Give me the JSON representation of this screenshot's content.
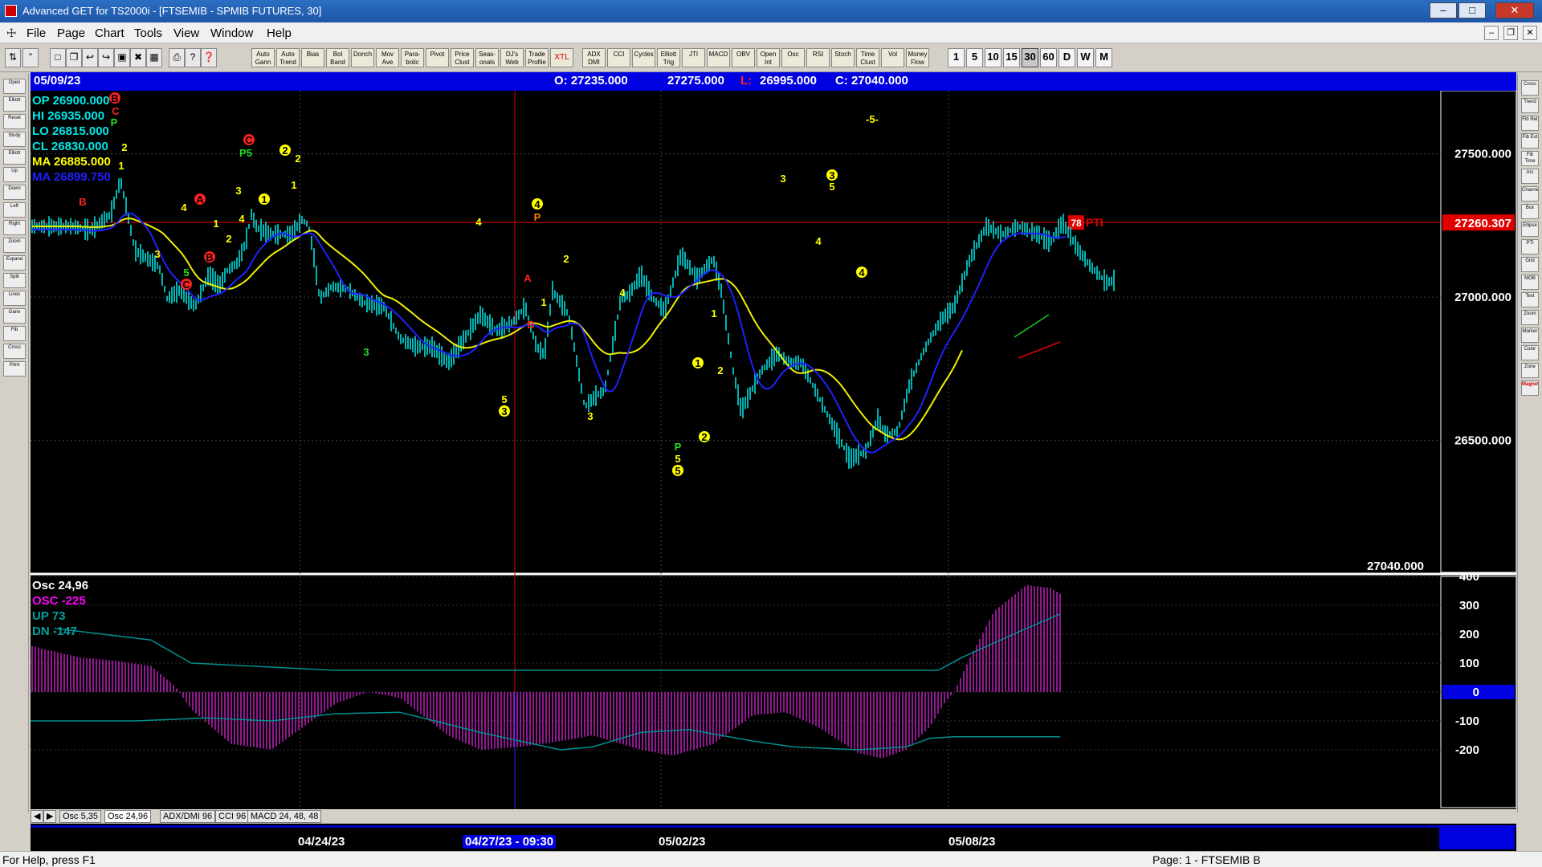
{
  "window": {
    "title": "Advanced GET for TS2000i - [FTSEMIB - SPMIB FUTURES, 30]"
  },
  "menu": [
    "File",
    "Page",
    "Chart",
    "Tools",
    "View",
    "Window",
    "Help"
  ],
  "toolbar": {
    "studies": [
      "Auto Gann",
      "Auto Trend",
      "Bias",
      "Bol Band",
      "Donch",
      "Mov Ave",
      "Para-bolic",
      "Pivot",
      "Price Clust",
      "Seas-onals",
      "DJ's Web",
      "Trade Profile",
      "XTL",
      "ADX DMI",
      "CCI",
      "Cycles",
      "Elliott Trig",
      "JTI",
      "MACD",
      "OBV",
      "Open Int",
      "Osc",
      "RSI",
      "Stoch",
      "Time Clust",
      "Vol",
      "Money Flow"
    ],
    "timeframes": [
      "1",
      "5",
      "10",
      "15",
      "30",
      "60",
      "D",
      "W",
      "M"
    ],
    "active_timeframe": "30"
  },
  "left_tools": [
    "Open",
    "Elliott",
    "Reset",
    "Study",
    "Elliott",
    "Up",
    "Down",
    "Left",
    "Right",
    "Zoom",
    "Expand",
    "Split",
    "Lines",
    "Gann",
    "Fib",
    "Cross",
    "Print"
  ],
  "right_tools": [
    "Cross",
    "Trend",
    "Fib Ret",
    "Fib Ext",
    "Fib Time",
    "Arc",
    "Channel",
    "Box",
    "Ellipse",
    "PTI",
    "Grid",
    "MOB",
    "Text",
    "Zoom",
    "Marker",
    "Color",
    "Zone",
    "Magnet"
  ],
  "header": {
    "date": "05/09/23",
    "open": "O: 27235.000",
    "high": "27275.000",
    "low_label": "L:",
    "low": "26995.000",
    "close": "C: 27040.000"
  },
  "info": {
    "op": "OP  26900.000",
    "hi": "HI   26935.000",
    "lo": "LO  26815.000",
    "cl": "CL  26830.000",
    "ma1": "MA  26885.000",
    "ma2": "MA  26899.750"
  },
  "price_axis": {
    "labels": [
      "27500.000",
      "27000.000",
      "26500.000"
    ],
    "current": "27260.307",
    "last": "27040.000",
    "ylim": [
      26040,
      27720
    ]
  },
  "pti": {
    "value": "78",
    "label": "PTI"
  },
  "osc_info": {
    "title": "Osc 24,96",
    "osc": "OSC -225",
    "up": "UP   73",
    "dn": "DN   -147"
  },
  "osc_axis": {
    "labels": [
      "400",
      "300",
      "200",
      "100",
      "0",
      "-100",
      "-200"
    ],
    "ylim": [
      -400,
      400
    ]
  },
  "tabs": [
    "Osc 5,35",
    "Osc 24,96",
    "ADX/DMI 96",
    "CCI 96",
    "MACD 24, 48, 48"
  ],
  "active_tab": "Osc 24,96",
  "dates": {
    "d1": "04/24/23",
    "cursor": "04/27/23 - 09:30",
    "d2": "05/02/23",
    "d3": "05/08/23"
  },
  "status": {
    "left": "For Help, press F1",
    "right": "Page: 1 - FTSEMIB B"
  },
  "elliott_labels": [
    {
      "t": "B",
      "x": 105,
      "y": 32,
      "c": "circle-red"
    },
    {
      "t": "C",
      "x": 106,
      "y": 48,
      "c": "red"
    },
    {
      "t": "P",
      "x": 104,
      "y": 62,
      "c": "green"
    },
    {
      "t": "2",
      "x": 117,
      "y": 93,
      "c": "yellow"
    },
    {
      "t": "1",
      "x": 113,
      "y": 116,
      "c": "yellow"
    },
    {
      "t": "B",
      "x": 65,
      "y": 161,
      "c": "red"
    },
    {
      "t": "A",
      "x": 211,
      "y": 158,
      "c": "circle-red"
    },
    {
      "t": "4",
      "x": 191,
      "y": 168,
      "c": "yellow"
    },
    {
      "t": "3",
      "x": 158,
      "y": 226,
      "c": "yellow"
    },
    {
      "t": "5",
      "x": 194,
      "y": 249,
      "c": "green"
    },
    {
      "t": "C",
      "x": 194,
      "y": 264,
      "c": "circle-red"
    },
    {
      "t": "B",
      "x": 223,
      "y": 230,
      "c": "circle-red"
    },
    {
      "t": "C",
      "x": 272,
      "y": 84,
      "c": "circle-red"
    },
    {
      "t": "P5",
      "x": 268,
      "y": 100,
      "c": "green"
    },
    {
      "t": "2",
      "x": 317,
      "y": 97,
      "c": "circle-yellow"
    },
    {
      "t": "2",
      "x": 333,
      "y": 107,
      "c": "yellow"
    },
    {
      "t": "3",
      "x": 259,
      "y": 147,
      "c": "yellow"
    },
    {
      "t": "1",
      "x": 291,
      "y": 158,
      "c": "circle-yellow"
    },
    {
      "t": "1",
      "x": 328,
      "y": 140,
      "c": "yellow"
    },
    {
      "t": "1",
      "x": 231,
      "y": 188,
      "c": "yellow"
    },
    {
      "t": "4",
      "x": 263,
      "y": 182,
      "c": "yellow"
    },
    {
      "t": "2",
      "x": 247,
      "y": 207,
      "c": "yellow"
    },
    {
      "t": "4",
      "x": 558,
      "y": 186,
      "c": "yellow"
    },
    {
      "t": "3",
      "x": 418,
      "y": 348,
      "c": "green"
    },
    {
      "t": "5",
      "x": 590,
      "y": 407,
      "c": "yellow"
    },
    {
      "t": "3",
      "x": 590,
      "y": 422,
      "c": "circle-yellow"
    },
    {
      "t": "4",
      "x": 631,
      "y": 164,
      "c": "circle-yellow"
    },
    {
      "t": "P",
      "x": 631,
      "y": 180,
      "c": "orange"
    },
    {
      "t": "2",
      "x": 667,
      "y": 232,
      "c": "yellow"
    },
    {
      "t": "A",
      "x": 619,
      "y": 256,
      "c": "red"
    },
    {
      "t": "1",
      "x": 639,
      "y": 286,
      "c": "yellow"
    },
    {
      "t": "B",
      "x": 623,
      "y": 314,
      "c": "red"
    },
    {
      "t": "4",
      "x": 737,
      "y": 274,
      "c": "yellow"
    },
    {
      "t": "3",
      "x": 697,
      "y": 428,
      "c": "yellow"
    },
    {
      "t": "P",
      "x": 806,
      "y": 466,
      "c": "green"
    },
    {
      "t": "5",
      "x": 806,
      "y": 481,
      "c": "yellow"
    },
    {
      "t": "5",
      "x": 806,
      "y": 496,
      "c": "circle-yellow"
    },
    {
      "t": "1",
      "x": 831,
      "y": 362,
      "c": "circle-yellow"
    },
    {
      "t": "2",
      "x": 839,
      "y": 454,
      "c": "circle-yellow"
    },
    {
      "t": "1",
      "x": 851,
      "y": 300,
      "c": "yellow"
    },
    {
      "t": "2",
      "x": 859,
      "y": 371,
      "c": "yellow"
    },
    {
      "t": "3",
      "x": 937,
      "y": 132,
      "c": "yellow"
    },
    {
      "t": "3",
      "x": 998,
      "y": 128,
      "c": "circle-yellow"
    },
    {
      "t": "5",
      "x": 998,
      "y": 142,
      "c": "yellow"
    },
    {
      "t": "4",
      "x": 981,
      "y": 210,
      "c": "yellow"
    },
    {
      "t": "4",
      "x": 1035,
      "y": 249,
      "c": "circle-yellow"
    },
    {
      "t": "-5-",
      "x": 1048,
      "y": 58,
      "c": "yellow"
    }
  ]
}
